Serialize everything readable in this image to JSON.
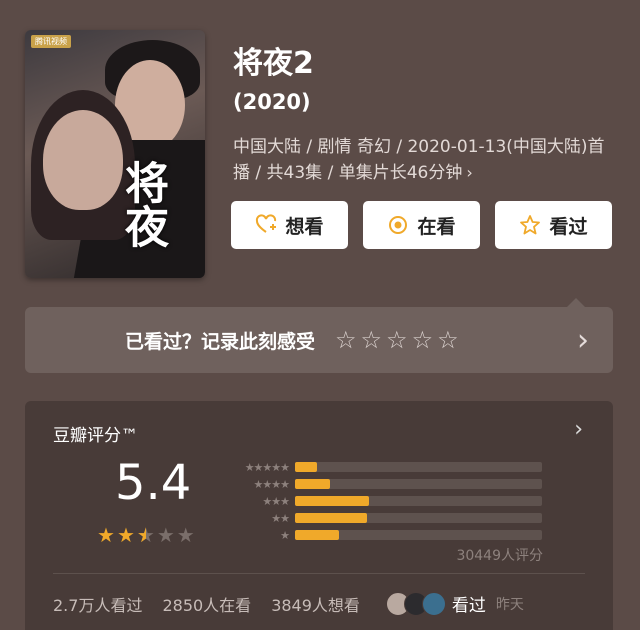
{
  "movie": {
    "title": "将夜2",
    "year": "(2020)",
    "meta_line": "中国大陆 / 剧情 奇幻 / 2020-01-13(中国大陆)首播 / 共43集 / 单集片长46分钟",
    "poster_title": "将夜",
    "poster_tag": "腾讯视频"
  },
  "actions": {
    "want_label": "想看",
    "watching_label": "在看",
    "watched_label": "看过"
  },
  "record": {
    "label": "已看过？记录此刻感受",
    "stars": 5
  },
  "rating": {
    "header": "豆瓣评分™",
    "score": "5.4",
    "star_value": 2.5,
    "distribution": [
      {
        "stars": "★★★★★",
        "fraction": 0.09
      },
      {
        "stars": "★★★★",
        "fraction": 0.14
      },
      {
        "stars": "★★★",
        "fraction": 0.3
      },
      {
        "stars": "★★",
        "fraction": 0.29
      },
      {
        "stars": "★",
        "fraction": 0.18
      }
    ],
    "count_text": "30449人评分"
  },
  "footer": {
    "watched_count": "2.7万人看过",
    "watching_count": "2850人在看",
    "want_count": "3849人想看",
    "friends_action": "看过",
    "friends_time": "昨天"
  },
  "colors": {
    "background": "#5b4b47",
    "accent": "#f0a92a",
    "panel": "#483b38"
  }
}
